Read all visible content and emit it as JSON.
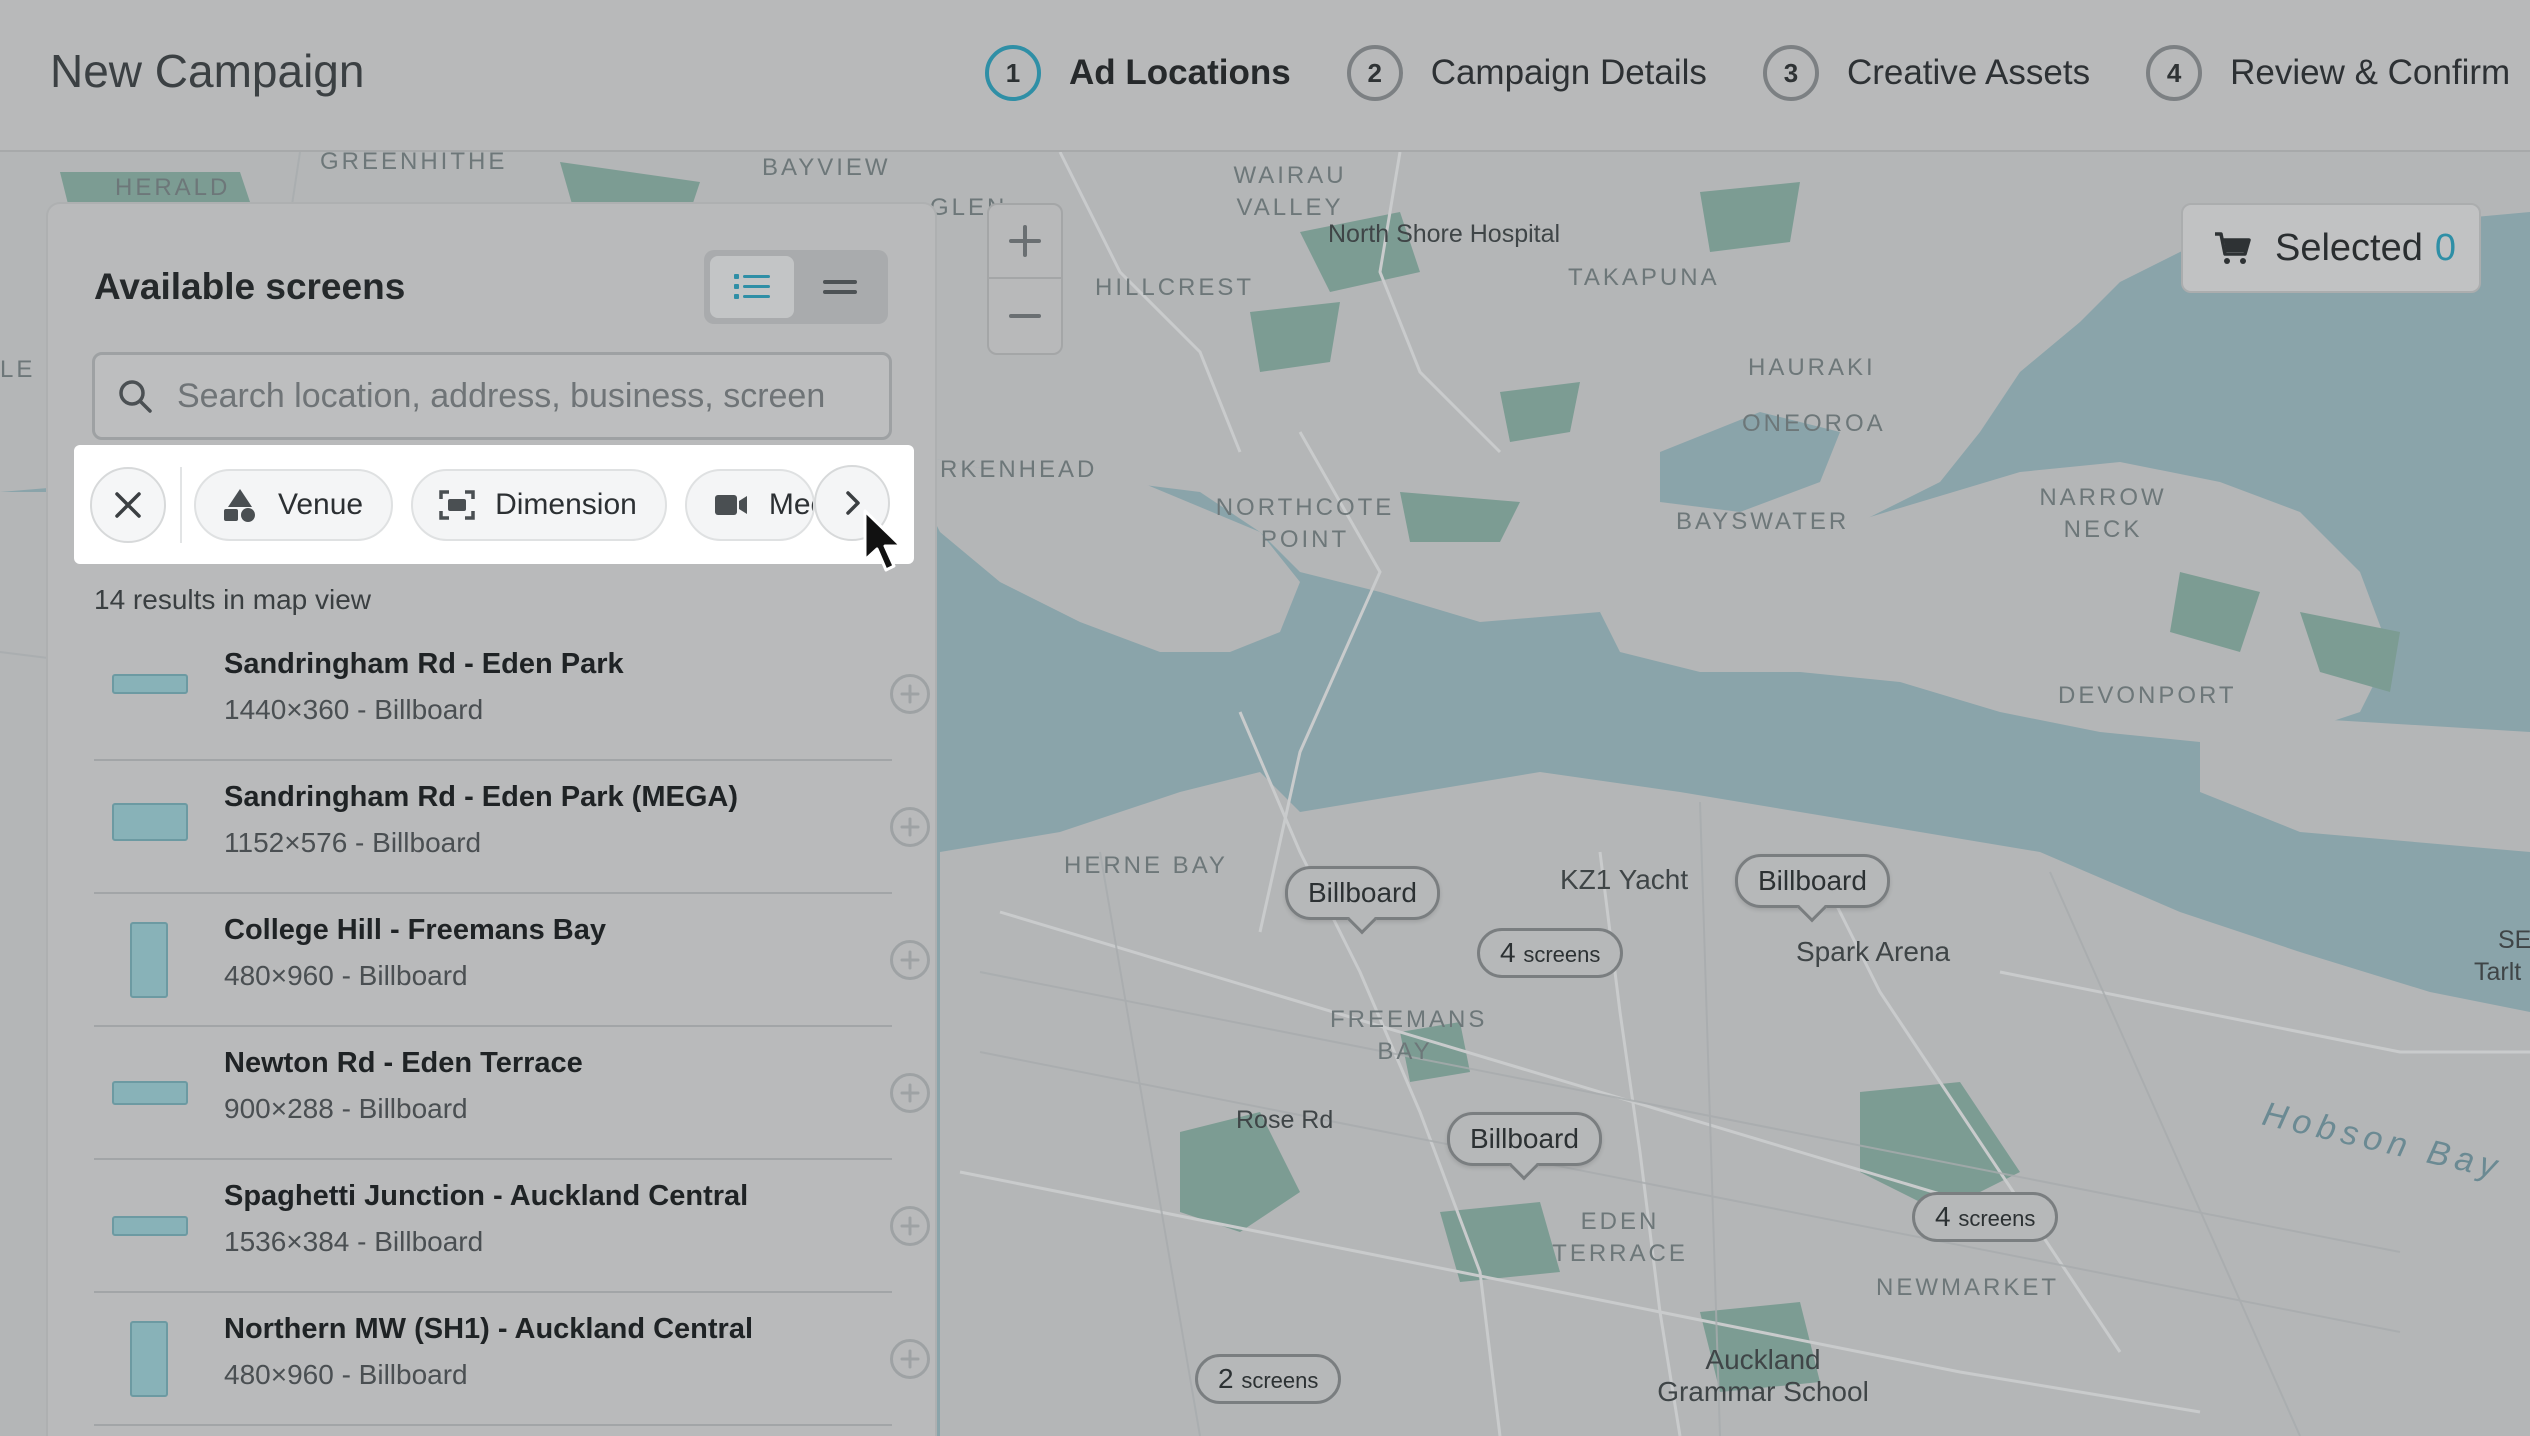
{
  "header": {
    "title": "New Campaign",
    "steps": [
      {
        "number": "1",
        "label": "Ad Locations"
      },
      {
        "number": "2",
        "label": "Campaign Details"
      },
      {
        "number": "3",
        "label": "Creative Assets"
      },
      {
        "number": "4",
        "label": "Review & Confirm"
      }
    ]
  },
  "cart": {
    "label": "Selected",
    "count": "0"
  },
  "panel": {
    "title": "Available screens",
    "search_placeholder": "Search location, address, business, screen",
    "filters": [
      {
        "label": "Venue",
        "icon": "venue-icon"
      },
      {
        "label": "Dimension",
        "icon": "dimension-icon"
      },
      {
        "label": "Media",
        "icon": "video-icon"
      }
    ],
    "results_text": "14 results in map view",
    "screens": [
      {
        "name": "Sandringham Rd - Eden Park",
        "detail": "1440×360 - Billboard"
      },
      {
        "name": "Sandringham Rd - Eden Park (MEGA)",
        "detail": "1152×576 - Billboard"
      },
      {
        "name": "College Hill - Freemans Bay",
        "detail": "480×960 - Billboard"
      },
      {
        "name": "Newton Rd - Eden Terrace",
        "detail": "900×288 - Billboard"
      },
      {
        "name": "Spaghetti Junction - Auckland Central",
        "detail": "1536×384 - Billboard"
      },
      {
        "name": "Northern MW (SH1) - Auckland Central",
        "detail": "480×960 - Billboard"
      }
    ]
  },
  "map": {
    "districts": [
      "Greenhithe",
      "Herald",
      "Bayview",
      "Wairau Valley",
      "Glen",
      "Hillcrest",
      "Takapuna",
      "Hauraki",
      "Oneoroa",
      "Northcote Point",
      "Bayswater",
      "Narrow Neck",
      "Devonport",
      "Herne Bay",
      "Freemans Bay",
      "Eden Terrace",
      "Newmarket",
      "Rkenhead",
      "Le"
    ],
    "places": [
      "North Shore Hospital",
      "KZ1 Yacht",
      "Spark Arena",
      "Rose Rd",
      "Auckland Grammar School",
      "SE",
      "Tarlt"
    ],
    "water_label": "Hobson Bay",
    "pins": [
      "Billboard",
      "Billboard",
      "Billboard"
    ],
    "clusters": [
      {
        "count": "4",
        "unit": "screens"
      },
      {
        "count": "4",
        "unit": "screens"
      },
      {
        "count": "2",
        "unit": "screens"
      }
    ]
  },
  "colors": {
    "accent": "#2f8fa6",
    "thumb": "#88b2b8",
    "panel": "#b9babb",
    "map_water": "#8aa4aa"
  }
}
